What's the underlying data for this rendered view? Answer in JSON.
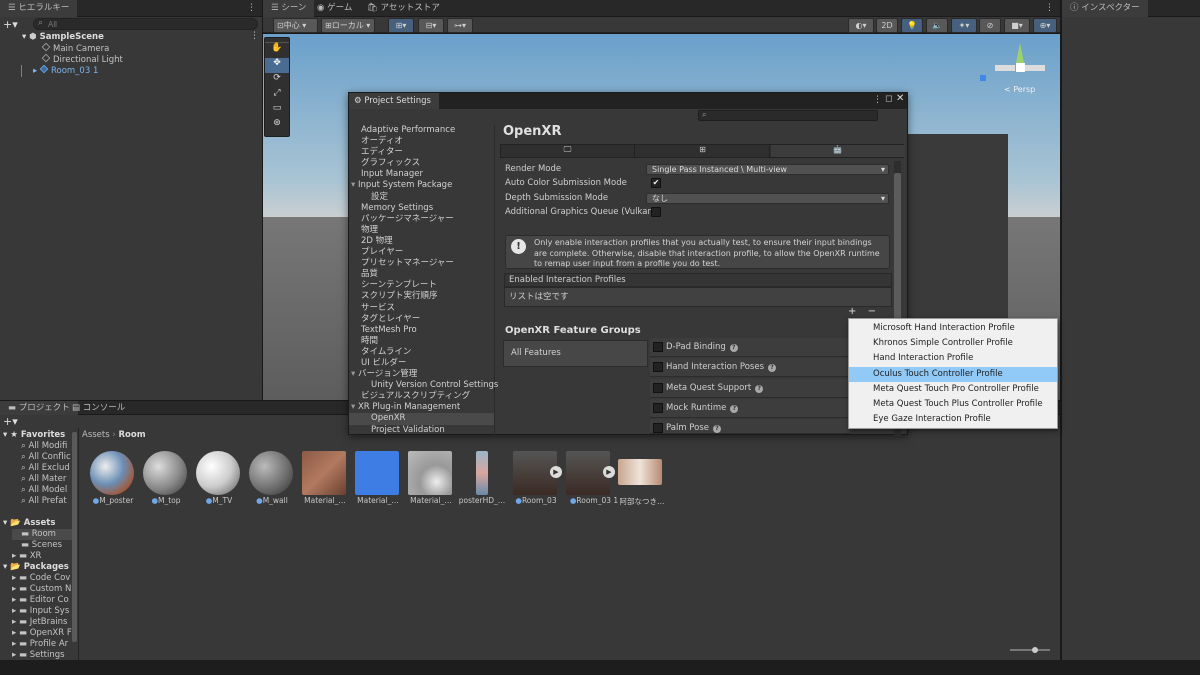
{
  "hierarchy": {
    "tab": "ヒエラルキー",
    "search_placeholder": "All",
    "scene": "SampleScene",
    "items": [
      "Main Camera",
      "Directional Light",
      "Room_03 1"
    ]
  },
  "scene": {
    "tabs": [
      "シーン",
      "ゲーム",
      "アセットストア"
    ],
    "pivot": "中心",
    "space": "ローカル",
    "mode_2d": "2D",
    "persp": "< Persp"
  },
  "inspector": {
    "tab": "インスペクター"
  },
  "settings": {
    "title": "Project Settings",
    "sidebar": [
      "Adaptive Performance",
      "オーディオ",
      "エディター",
      "グラフィックス",
      "Input Manager",
      "Input System Package",
      "設定",
      "Memory Settings",
      "パッケージマネージャー",
      "物理",
      "2D 物理",
      "プレイヤー",
      "プリセットマネージャー",
      "品質",
      "シーンテンプレート",
      "スクリプト実行順序",
      "サービス",
      "タグとレイヤー",
      "TextMesh Pro",
      "時間",
      "タイムライン",
      "UI ビルダー",
      "バージョン管理",
      "Unity Version Control Settings",
      "ビジュアルスクリプティング",
      "XR Plug-in Management",
      "OpenXR",
      "Project Validation"
    ],
    "heading": "OpenXR",
    "render_mode_label": "Render Mode",
    "render_mode_value": "Single Pass Instanced \\ Multi-view",
    "auto_color_label": "Auto Color Submission Mode",
    "depth_label": "Depth Submission Mode",
    "depth_value": "なし",
    "graphics_queue_label": "Additional Graphics Queue (Vulkan)",
    "info_text": "Only enable interaction profiles that you actually test, to ensure their input bindings are complete. Otherwise, disable that interaction profile, to allow the OpenXR runtime to remap user input from a profile you do test.",
    "profiles_header": "Enabled Interaction Profiles",
    "profiles_empty": "リストは空です",
    "plus": "+",
    "minus": "−",
    "feature_groups": "OpenXR Feature Groups",
    "all_features": "All Features",
    "features": [
      "D-Pad Binding",
      "Hand Interaction Poses",
      "Meta Quest Support",
      "Mock Runtime",
      "Palm Pose"
    ]
  },
  "popup": {
    "items": [
      "Microsoft Hand Interaction Profile",
      "Khronos Simple Controller Profile",
      "Hand Interaction Profile",
      "Oculus Touch Controller Profile",
      "Meta Quest Touch Pro Controller Profile",
      "Meta Quest Touch Plus Controller Profile",
      "Eye Gaze Interaction Profile"
    ],
    "selected_index": 3
  },
  "project": {
    "tabs": [
      "プロジェクト",
      "コンソール"
    ],
    "favorites_label": "Favorites",
    "favorites": [
      "All Modifi",
      "All Conflic",
      "All Exclud",
      "All Mater",
      "All Model",
      "All Prefat"
    ],
    "assets_label": "Assets",
    "assets_children": [
      "Room",
      "Scenes",
      "XR"
    ],
    "packages_label": "Packages",
    "packages": [
      "Code Cov",
      "Custom N",
      "Editor Co",
      "Input Sys",
      "JetBrains",
      "OpenXR F",
      "Profile Ar",
      "Settings"
    ],
    "breadcrumb": [
      "Assets",
      "Room"
    ],
    "assets": [
      "M_poster",
      "M_top",
      "M_TV",
      "M_wall",
      "Material_…",
      "Material_…",
      "Material_…",
      "posterHD_…",
      "Room_03",
      "Room_03 1",
      "阿部なつき…"
    ]
  }
}
